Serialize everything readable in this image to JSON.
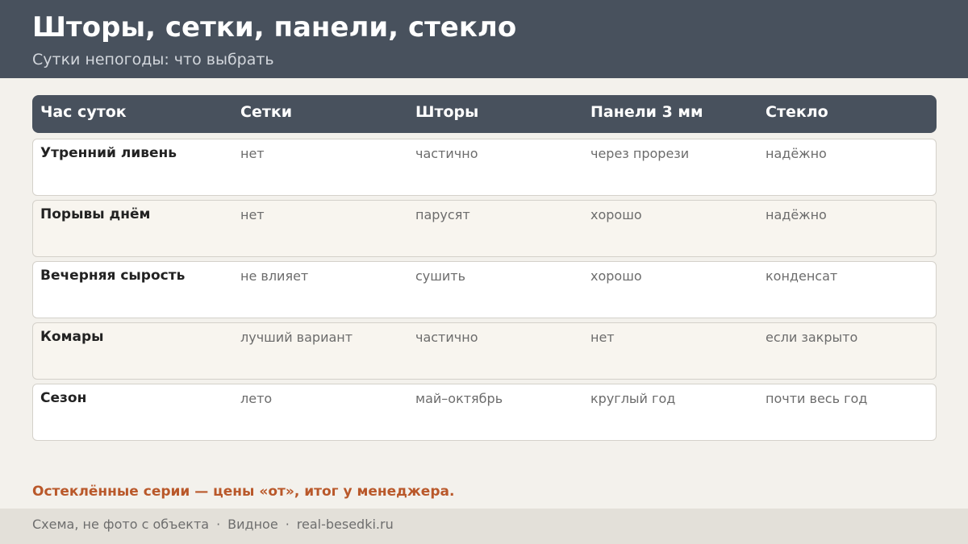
{
  "header": {
    "title": "Шторы, сетки, панели, стекло",
    "subtitle": "Сутки непогоды: что выбрать"
  },
  "table": {
    "columns": [
      "Час суток",
      "Сетки",
      "Шторы",
      "Панели 3 мм",
      "Стекло"
    ],
    "rows": [
      [
        "Утренний ливень",
        "нет",
        "частично",
        "через прорези",
        "надёжно"
      ],
      [
        "Порывы днём",
        "нет",
        "парусят",
        "хорошо",
        "надёжно"
      ],
      [
        "Вечерняя сырость",
        "не влияет",
        "сушить",
        "хорошо",
        "конденсат"
      ],
      [
        "Комары",
        "лучший вариант",
        "частично",
        "нет",
        "если закрыто"
      ],
      [
        "Сезон",
        "лето",
        "май–октябрь",
        "круглый год",
        "почти весь год"
      ]
    ]
  },
  "note": "Остеклённые серии — цены «от», итог у менеджера.",
  "footer": {
    "parts": [
      "Схема, не фото с объекта",
      "Видное",
      "real-besedki.ru"
    ],
    "separator": "·"
  },
  "colors": {
    "header_bg": "#48515d",
    "accent": "#b9582a",
    "page_bg": "#f3f1ec",
    "footer_bg": "#e3e0d9"
  }
}
